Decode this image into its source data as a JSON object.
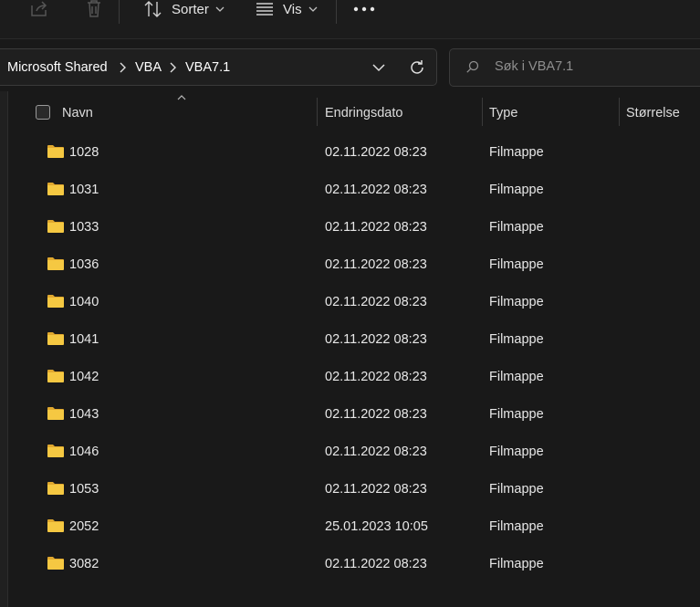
{
  "toolbar": {
    "share_icon": "share-icon",
    "delete_icon": "trash-icon",
    "sort_label": "Sorter",
    "view_label": "Vis",
    "more_icon": "ellipsis-icon"
  },
  "address_bar": {
    "crumbs": [
      "Microsoft Shared",
      "VBA",
      "VBA7.1"
    ]
  },
  "search": {
    "placeholder": "Søk i VBA7.1",
    "value": ""
  },
  "columns": {
    "name": "Navn",
    "date": "Endringsdato",
    "type": "Type",
    "size": "Størrelse"
  },
  "rows": [
    {
      "name": "1028",
      "date": "02.11.2022 08:23",
      "type": "Filmappe",
      "size": ""
    },
    {
      "name": "1031",
      "date": "02.11.2022 08:23",
      "type": "Filmappe",
      "size": ""
    },
    {
      "name": "1033",
      "date": "02.11.2022 08:23",
      "type": "Filmappe",
      "size": ""
    },
    {
      "name": "1036",
      "date": "02.11.2022 08:23",
      "type": "Filmappe",
      "size": ""
    },
    {
      "name": "1040",
      "date": "02.11.2022 08:23",
      "type": "Filmappe",
      "size": ""
    },
    {
      "name": "1041",
      "date": "02.11.2022 08:23",
      "type": "Filmappe",
      "size": ""
    },
    {
      "name": "1042",
      "date": "02.11.2022 08:23",
      "type": "Filmappe",
      "size": ""
    },
    {
      "name": "1043",
      "date": "02.11.2022 08:23",
      "type": "Filmappe",
      "size": ""
    },
    {
      "name": "1046",
      "date": "02.11.2022 08:23",
      "type": "Filmappe",
      "size": ""
    },
    {
      "name": "1053",
      "date": "02.11.2022 08:23",
      "type": "Filmappe",
      "size": ""
    },
    {
      "name": "2052",
      "date": "25.01.2023 10:05",
      "type": "Filmappe",
      "size": ""
    },
    {
      "name": "3082",
      "date": "02.11.2022 08:23",
      "type": "Filmappe",
      "size": ""
    }
  ],
  "colors": {
    "background": "#191919",
    "folder_yellow": "#f4c542",
    "text": "#e8e8e8"
  }
}
